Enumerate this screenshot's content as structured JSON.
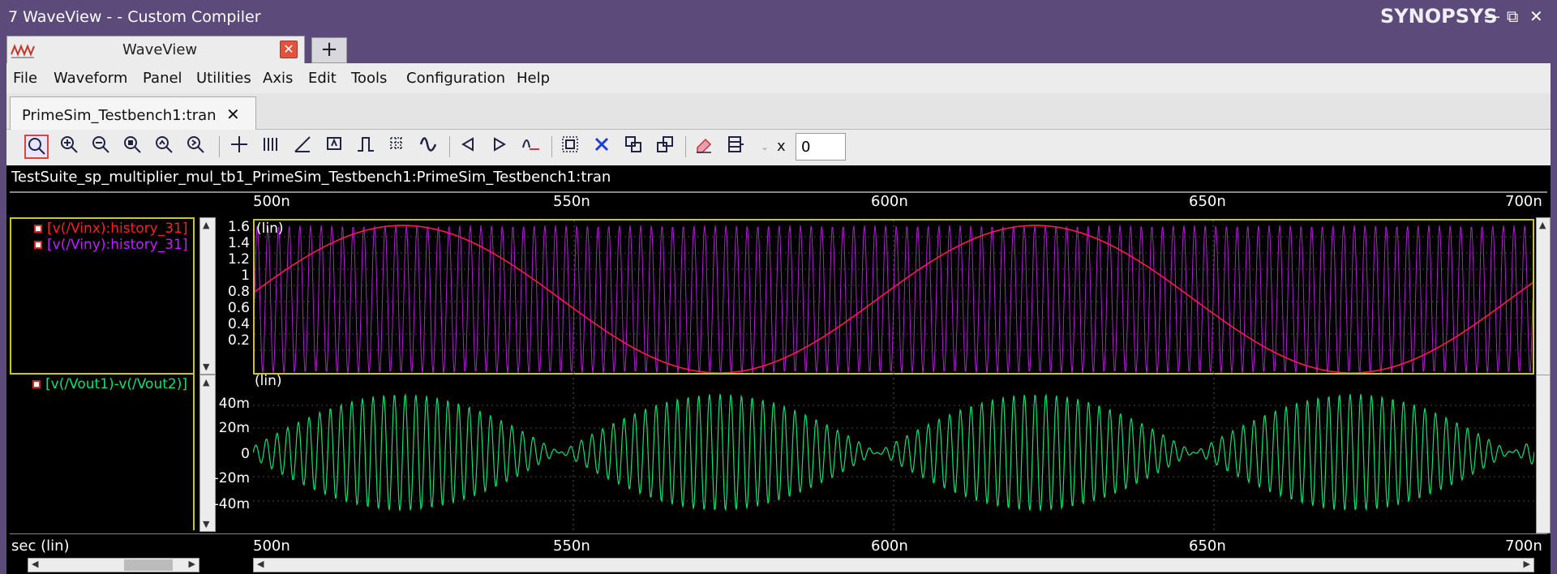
{
  "window": {
    "title": "7 WaveView -  - Custom Compiler",
    "brand": "SYNOPSYS",
    "controls": {
      "minimize": "—",
      "restore": "⧉",
      "close": "✕"
    }
  },
  "app_tab": {
    "label": "WaveView",
    "close": "✕",
    "add": "+"
  },
  "menu": [
    "File",
    "Waveform",
    "Panel",
    "Utilities",
    "Axis",
    "Edit",
    "Tools",
    "Configuration",
    "Help"
  ],
  "doc_tab": {
    "label": "PrimeSim_Testbench1:tran",
    "close": "✕"
  },
  "toolbar": {
    "x_label": "x",
    "x_value": "0",
    "icons": [
      "zoom-fit-icon",
      "zoom-in-icon",
      "zoom-out-icon",
      "zoom-full-icon",
      "zoom-y-icon",
      "zoom-x-icon",
      "cursor-icon",
      "bars-icon",
      "measure-icon",
      "annotation-icon",
      "pulse-icon",
      "grid-icon",
      "wave-icon",
      "prev-icon",
      "next-icon",
      "wave-edit-icon",
      "group-icon",
      "delete-icon",
      "copy-icon",
      "paste-icon",
      "eraser-icon",
      "layout-icon",
      "dropdown-icon"
    ]
  },
  "breadcrumb": "TestSuite_sp_multiplier_mul_tb1_PrimeSim_Testbench1:PrimeSim_Testbench1:tran",
  "x_axis": {
    "ticks": [
      "500n",
      "550n",
      "600n",
      "650n",
      "700n"
    ],
    "label": "sec (lin)"
  },
  "panel1": {
    "scale": "(lin)",
    "signals": [
      {
        "name": "[v(/Vinx):history_31]",
        "color": "#ff2020"
      },
      {
        "name": "[v(/Viny):history_31]",
        "color": "#c020ff"
      }
    ],
    "yticks": [
      "1.6",
      "1.4",
      "1.2",
      "1",
      "0.8",
      "0.6",
      "0.4",
      "0.2"
    ]
  },
  "panel2": {
    "scale": "(lin)",
    "signals": [
      {
        "name": "[v(/Vout1)-v(/Vout2)]",
        "color": "#10e070"
      }
    ],
    "yticks": [
      "40m",
      "20m",
      "0",
      "-20m",
      "-40m"
    ]
  },
  "colors": {
    "vinx": "#ff1a4a",
    "viny": "#b020d0",
    "vout": "#10e070",
    "frame": "#c8c820"
  }
}
